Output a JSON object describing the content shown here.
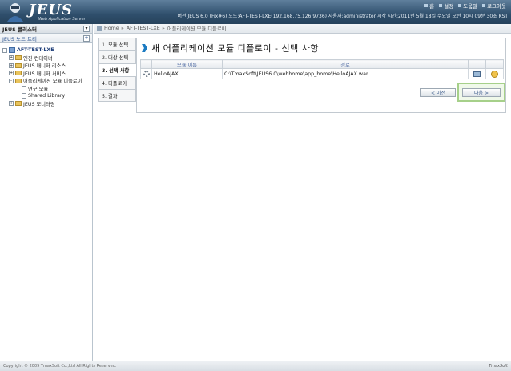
{
  "header": {
    "logo": "JEUS",
    "logo_sub": "Web Application Server",
    "nav": [
      "홈",
      "설정",
      "도움말",
      "로그아웃"
    ],
    "status": "버전:JEUS 6.0 (Fix#6)   노드:AFT-TEST-LXE(192.168.75.126:9736)   사용자:administrator   시작 시간:2011년 5월 18일 수요일 오전 10시 09분 30초 KST"
  },
  "left": {
    "cluster_title": "JEUS 클러스터",
    "node_tree_title": "JEUS 노드 트리",
    "tree": [
      {
        "label": "AFT-TEST-LXE",
        "level": 0,
        "toggle": "-",
        "icon": "server"
      },
      {
        "label": "엔진 컨테이너",
        "level": 1,
        "toggle": "+",
        "icon": "folder"
      },
      {
        "label": "JEUS 매니저 리소스",
        "level": 1,
        "toggle": "+",
        "icon": "folder"
      },
      {
        "label": "JEUS 매니저 서비스",
        "level": 1,
        "toggle": "+",
        "icon": "folder"
      },
      {
        "label": "어플리케이션 모듈 디플로이",
        "level": 1,
        "toggle": "-",
        "icon": "folder"
      },
      {
        "label": "연구 모듈",
        "level": 2,
        "toggle": "",
        "icon": "doc"
      },
      {
        "label": "Shared Library",
        "level": 2,
        "toggle": "",
        "icon": "doc"
      },
      {
        "label": "JEUS 모니터링",
        "level": 1,
        "toggle": "+",
        "icon": "folder"
      }
    ]
  },
  "breadcrumb": [
    "Home",
    "AFT-TEST-LXE",
    "어플리케이션 모듈 디플로이"
  ],
  "steps": [
    "1. 모듈 선택",
    "2. 대상 선택",
    "3. 선택 사항",
    "4. 디플로이",
    "5. 결과"
  ],
  "active_step": 2,
  "content": {
    "title": "새 어플리케이션 모듈 디플로이 - 선택 사항",
    "columns": [
      "",
      "모듈 이름",
      "경로",
      "",
      ""
    ],
    "rows": [
      {
        "name": "HelloAJAX",
        "path": "C:\\TmaxSoft\\JEUS6.0\\webhome\\app_home\\HelloAJAX.war"
      }
    ],
    "prev_label": "< 이전",
    "next_label": "다음 >"
  },
  "footer": {
    "copyright": "Copyright © 2009 TmaxSoft Co.,Ltd All Rights Reserved.",
    "brand": "TmaxSoft"
  },
  "colors": {
    "header_top": "#5f7f9c",
    "header_bottom": "#27435c",
    "accent_blue": "#1b7bc2",
    "highlight_green": "#a6d08a"
  }
}
